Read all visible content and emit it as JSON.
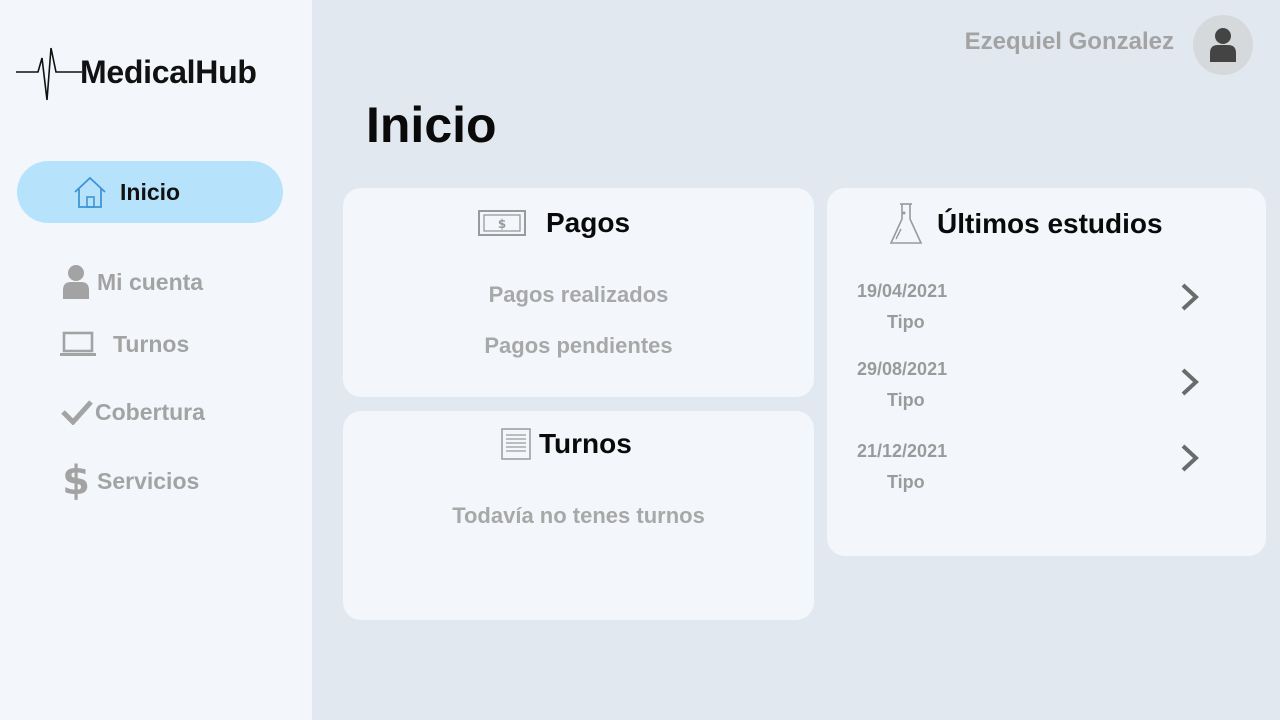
{
  "app": {
    "name": "MedicalHub"
  },
  "user": {
    "name": "Ezequiel Gonzalez"
  },
  "sidebar": {
    "items": [
      {
        "label": "Inicio",
        "icon": "home-icon",
        "active": true
      },
      {
        "label": "Mi cuenta",
        "icon": "user-icon"
      },
      {
        "label": "Turnos",
        "icon": "laptop-icon"
      },
      {
        "label": "Cobertura",
        "icon": "check-icon"
      },
      {
        "label": "Servicios",
        "icon": "dollar-icon"
      }
    ]
  },
  "page": {
    "title": "Inicio"
  },
  "pagos": {
    "title": "Pagos",
    "icon": "banknote-icon",
    "links": [
      "Pagos realizados",
      "Pagos pendientes"
    ]
  },
  "turnos": {
    "title": "Turnos",
    "icon": "document-icon",
    "empty_text": "Todavía no tenes turnos"
  },
  "estudios": {
    "title": "Últimos estudios",
    "icon": "flask-icon",
    "items": [
      {
        "date": "19/04/2021",
        "type": "Tipo"
      },
      {
        "date": "29/08/2021",
        "type": "Tipo"
      },
      {
        "date": "21/12/2021",
        "type": "Tipo"
      }
    ]
  },
  "colors": {
    "sidebar_bg": "#f3f7fc",
    "main_bg": "#e2e8ef",
    "active_nav": "#b6e3fb",
    "muted_text": "#a3a3a3"
  }
}
